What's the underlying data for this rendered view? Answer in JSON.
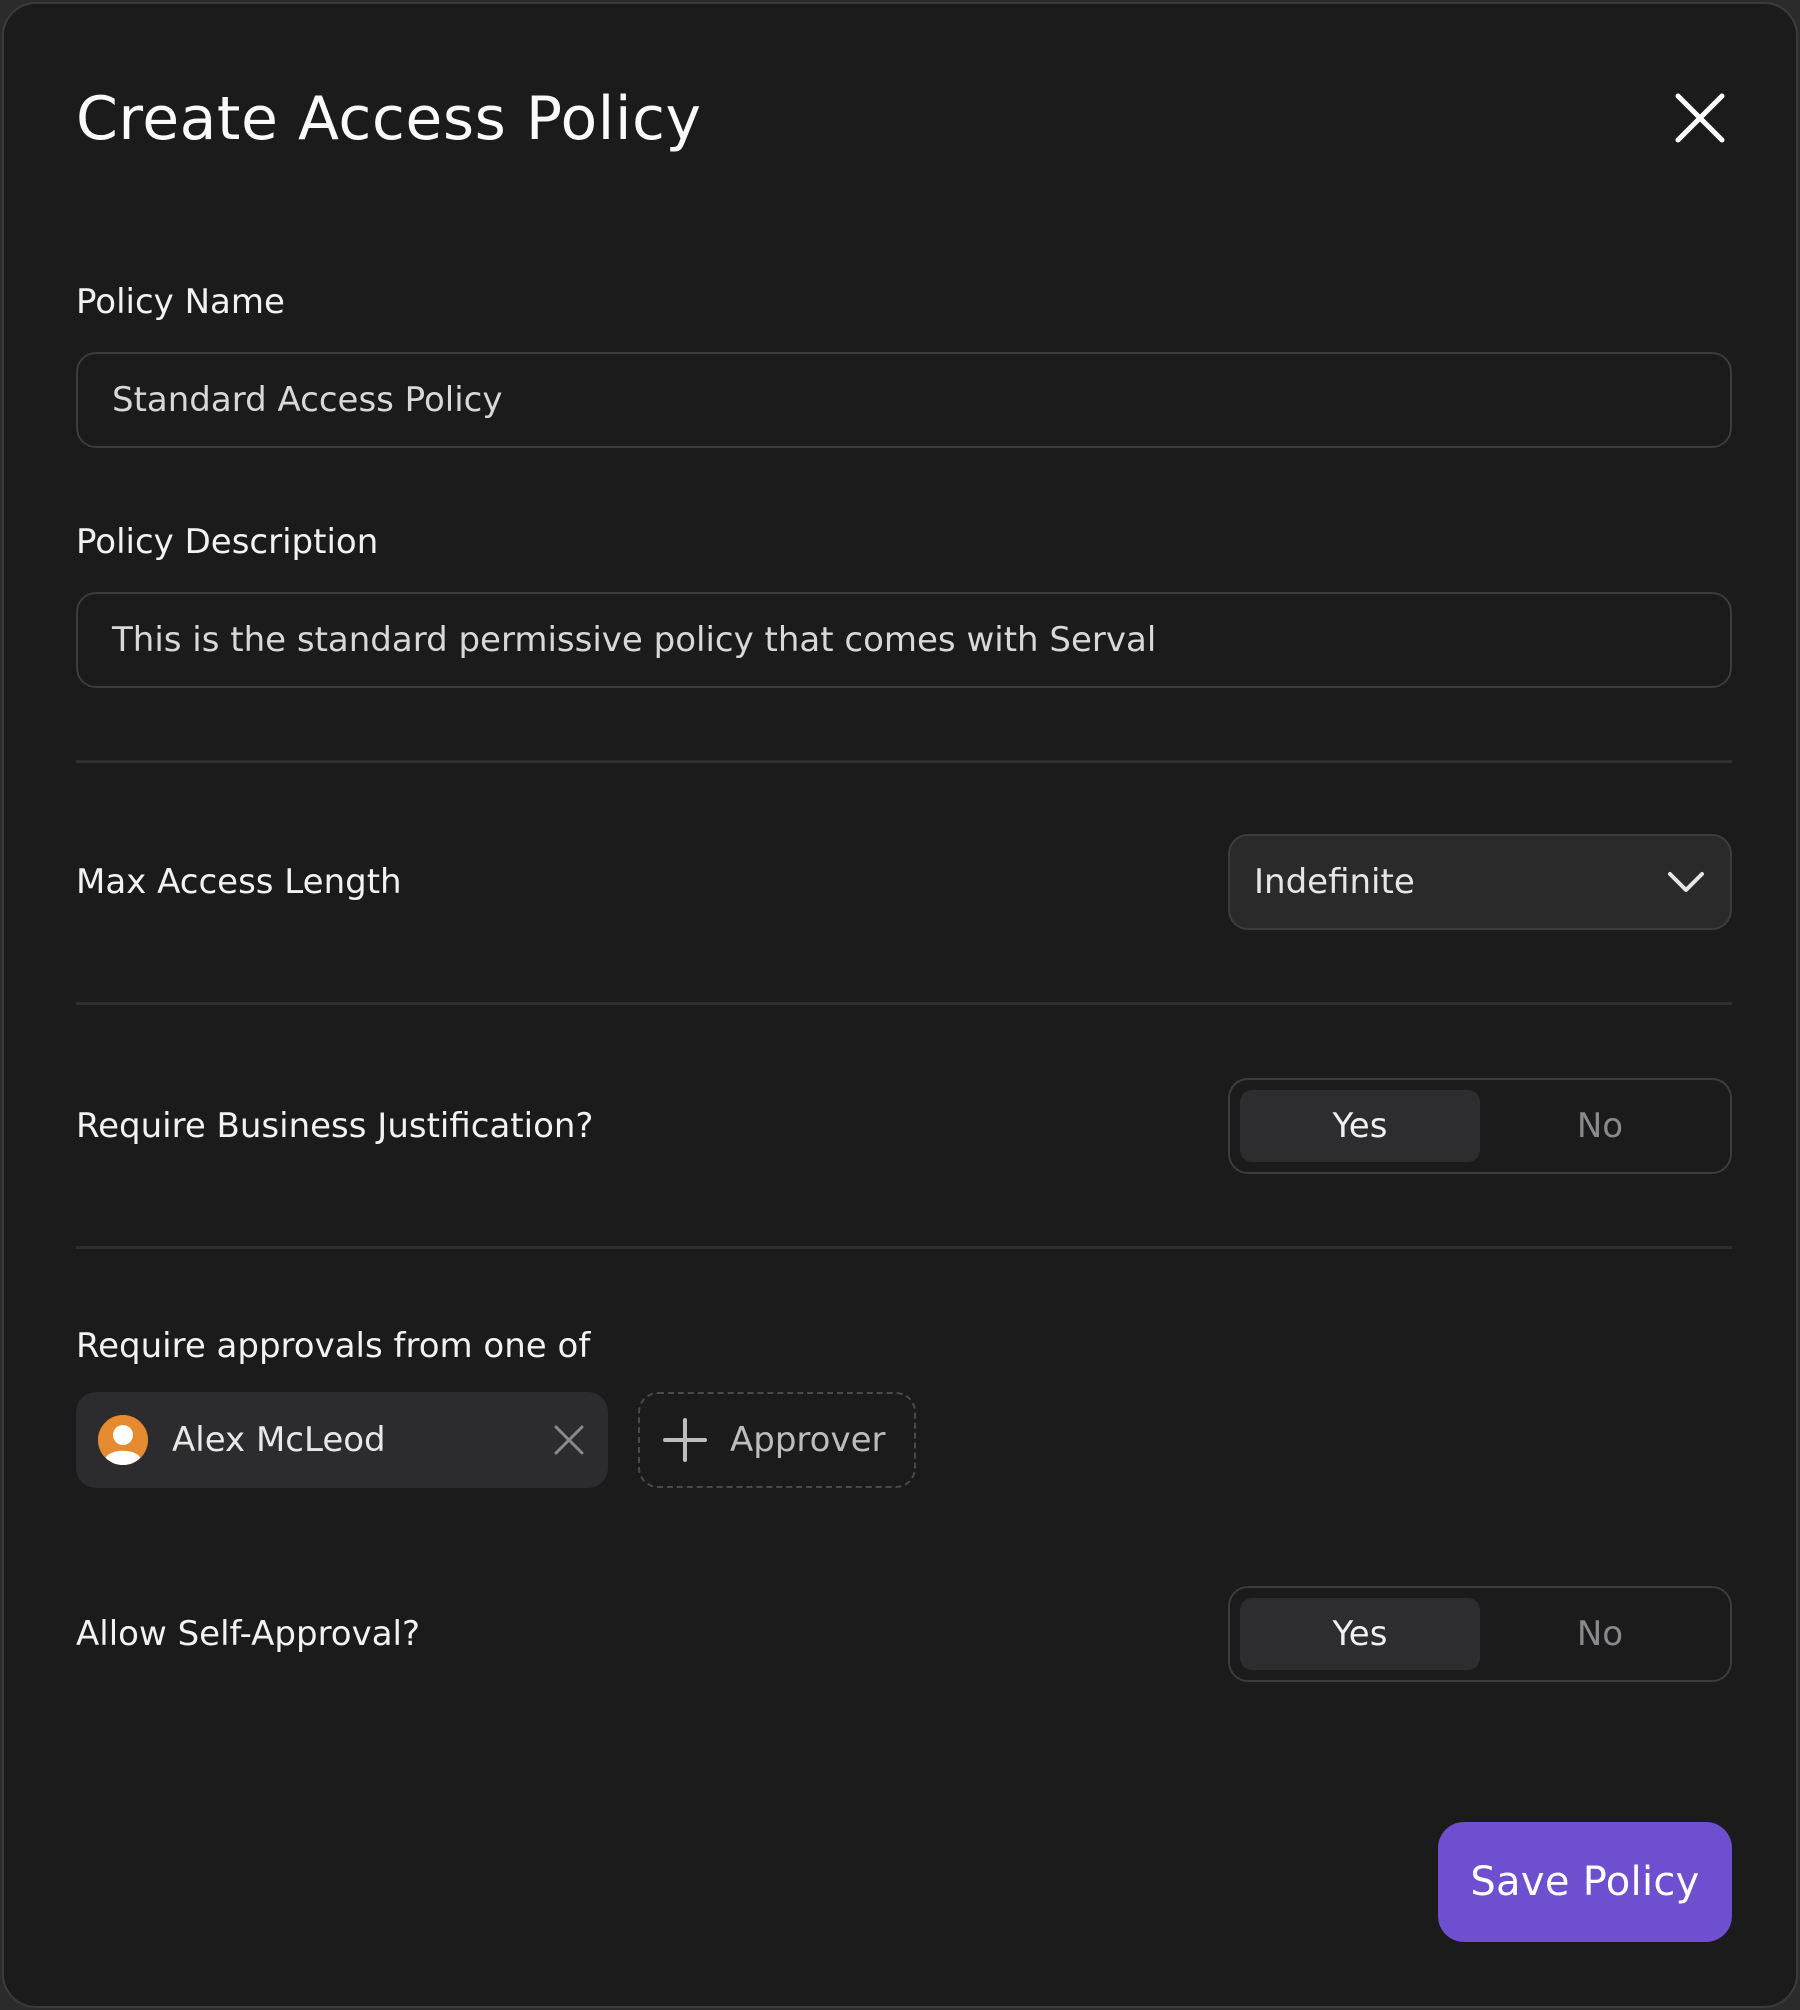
{
  "modal": {
    "title": "Create Access Policy",
    "close_icon": "close-icon"
  },
  "policy_name": {
    "label": "Policy Name",
    "value": "Standard Access Policy"
  },
  "policy_description": {
    "label": "Policy Description",
    "value": "This is the standard permissive policy that comes with Serval"
  },
  "max_access_length": {
    "label": "Max Access Length",
    "selected": "Indefinite",
    "icon": "chevron-down-icon"
  },
  "business_justification": {
    "label": "Require Business Justification?",
    "options": [
      "Yes",
      "No"
    ],
    "selected": "Yes"
  },
  "approvals": {
    "label": "Require approvals from one of",
    "approvers": [
      {
        "name": "Alex McLeod",
        "avatar_icon": "user-avatar-icon",
        "avatar_color": "#e58a2e"
      }
    ],
    "add_label": "Approver",
    "add_icon": "plus-icon"
  },
  "self_approval": {
    "label": "Allow Self-Approval?",
    "options": [
      "Yes",
      "No"
    ],
    "selected": "Yes"
  },
  "footer": {
    "save_label": "Save Policy",
    "accent_color": "#6d4fcf"
  }
}
